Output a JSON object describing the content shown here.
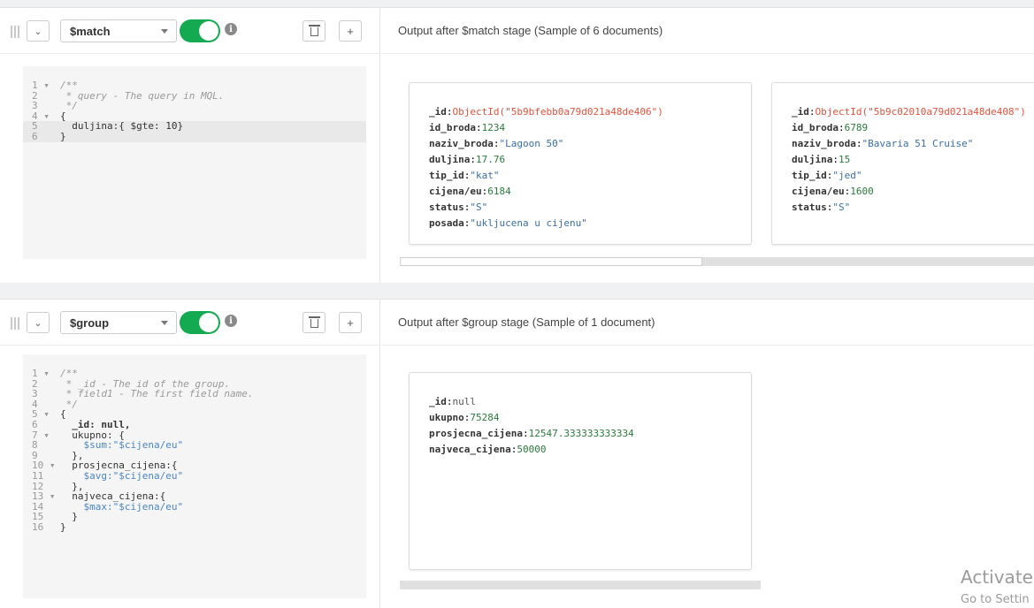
{
  "stages": [
    {
      "operator": "$match",
      "output_title": "Output after $match stage (Sample of 6 documents)",
      "code": [
        {
          "n": "1 ▾",
          "t": "/**"
        },
        {
          "n": "2",
          "t": " * query - The query in MQL."
        },
        {
          "n": "3",
          "t": " */"
        },
        {
          "n": "4 ▾",
          "t": "{"
        },
        {
          "n": "5",
          "t": "  duljina:{ $gte: 10}"
        },
        {
          "n": "6",
          "t": "}"
        }
      ],
      "documents": [
        [
          {
            "k": "_id",
            "v": "ObjectId(\"5b9bfebb0a79d021a48de406\")"
          },
          {
            "k": "id_broda",
            "v": "1234"
          },
          {
            "k": "naziv_broda",
            "v": "\"Lagoon 50\""
          },
          {
            "k": "duljina",
            "v": "17.76"
          },
          {
            "k": "tip_id",
            "v": "\"kat\""
          },
          {
            "k": "cijena/eu",
            "v": "6184"
          },
          {
            "k": "status",
            "v": "\"S\""
          },
          {
            "k": "posada",
            "v": "\"ukljucena u cijenu\""
          }
        ],
        [
          {
            "k": "_id",
            "v": "ObjectId(\"5b9c02010a79d021a48de408\")"
          },
          {
            "k": "id_broda",
            "v": "6789"
          },
          {
            "k": "naziv_broda",
            "v": "\"Bavaria 51 Cruise\""
          },
          {
            "k": "duljina",
            "v": "15"
          },
          {
            "k": "tip_id",
            "v": "\"jed\""
          },
          {
            "k": "cijena/eu",
            "v": "1600"
          },
          {
            "k": "status",
            "v": "\"S\""
          }
        ]
      ]
    },
    {
      "operator": "$group",
      "output_title": "Output after $group stage (Sample of 1 document)",
      "code": [
        {
          "n": "1 ▾",
          "t": "/**"
        },
        {
          "n": "2",
          "t": " * _id - The id of the group."
        },
        {
          "n": "3",
          "t": " * field1 - The first field name."
        },
        {
          "n": "4",
          "t": " */"
        },
        {
          "n": "5 ▾",
          "t": "{"
        },
        {
          "n": "6",
          "t": "  _id: null,"
        },
        {
          "n": "7 ▾",
          "t": "  ukupno: {"
        },
        {
          "n": "8",
          "t": "    $sum:\"$cijena/eu\""
        },
        {
          "n": "9",
          "t": "  },"
        },
        {
          "n": "10 ▾",
          "t": "  prosjecna_cijena:{"
        },
        {
          "n": "11",
          "t": "    $avg:\"$cijena/eu\""
        },
        {
          "n": "12",
          "t": "  },"
        },
        {
          "n": "13 ▾",
          "t": "  najveca_cijena:{"
        },
        {
          "n": "14",
          "t": "    $max:\"$cijena/eu\""
        },
        {
          "n": "15",
          "t": "  }"
        },
        {
          "n": "16",
          "t": "}"
        }
      ],
      "documents": [
        [
          {
            "k": "_id",
            "v": "null"
          },
          {
            "k": "ukupno",
            "v": "75284"
          },
          {
            "k": "prosjecna_cijena",
            "v": "12547.333333333334"
          },
          {
            "k": "najveca_cijena",
            "v": "50000"
          }
        ]
      ]
    }
  ],
  "icons": {
    "collapse": "chevron-down-icon",
    "info": "info-icon",
    "delete": "trash-icon",
    "add": "plus-icon"
  },
  "labels": {
    "info_glyph": "i",
    "add_glyph": "+",
    "collapse_glyph": "⌄"
  },
  "colors": {
    "toggle_on": "#13aa52",
    "object_id": "#e0533c",
    "number": "#2b7a3b",
    "string": "#3a6ea5"
  },
  "watermark": {
    "line1": "Activate",
    "line2": "Go to Settin"
  }
}
